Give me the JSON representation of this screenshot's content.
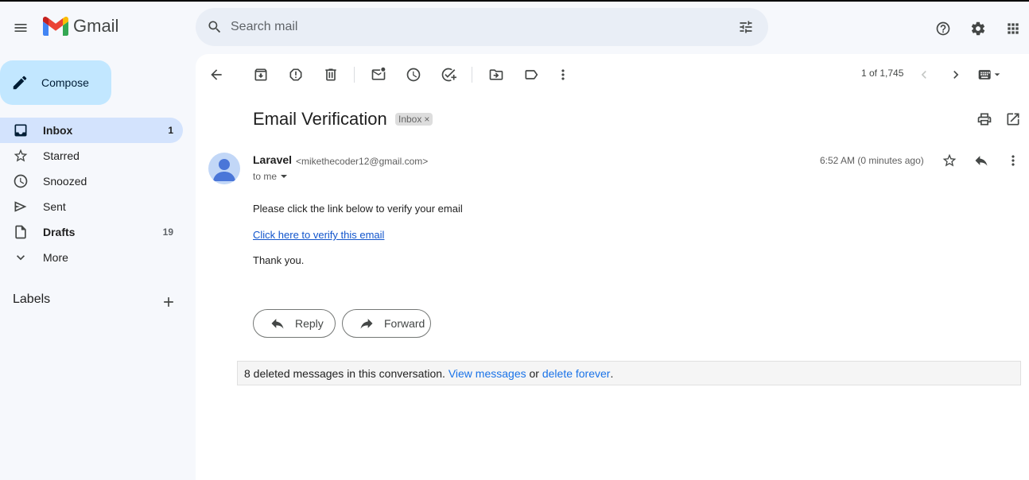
{
  "header": {
    "logo_text": "Gmail",
    "search_placeholder": "Search mail"
  },
  "sidebar": {
    "compose_label": "Compose",
    "items": [
      {
        "label": "Inbox",
        "count": "1"
      },
      {
        "label": "Starred",
        "count": ""
      },
      {
        "label": "Snoozed",
        "count": ""
      },
      {
        "label": "Sent",
        "count": ""
      },
      {
        "label": "Drafts",
        "count": "19"
      },
      {
        "label": "More",
        "count": ""
      }
    ],
    "labels_heading": "Labels"
  },
  "toolbar": {
    "pager_text": "1 of 1,745"
  },
  "email": {
    "subject": "Email Verification",
    "label_chip": "Inbox",
    "sender_name": "Laravel",
    "sender_email": "<mikethecoder12@gmail.com>",
    "recipient": "to me",
    "time": "6:52 AM (0 minutes ago)",
    "body_line1": "Please click the link below to verify your email",
    "link_text": "Click here to verify this email",
    "signoff": "Thank you."
  },
  "actions": {
    "reply_label": "Reply",
    "forward_label": "Forward"
  },
  "deleted_bar": {
    "text": "8 deleted messages in this conversation. ",
    "view_link": "View messages",
    "or_text": " or ",
    "delete_link": "delete forever",
    "end": "."
  },
  "colors": {
    "background": "#f6f8fc",
    "compose": "#c2e7ff",
    "active_nav": "#d3e3fd",
    "link": "#1155cc"
  }
}
